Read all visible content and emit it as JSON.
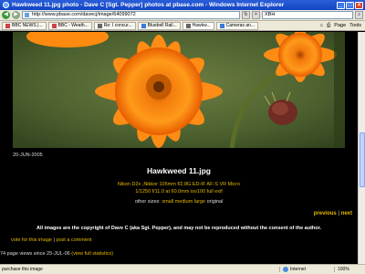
{
  "window": {
    "title": "Hawkweed 11.jpg photo - Dave C [Sgt. Pepper] photos at pbase.com - Windows Internet Explorer"
  },
  "address": {
    "url": "http://www.pbase.com/davecj/image/64099072",
    "search_value": "XBH"
  },
  "tabs": [
    {
      "label": "BBC NEWS |..."
    },
    {
      "label": "BBC - Weath..."
    },
    {
      "label": "Re: I concur..."
    },
    {
      "label": "Bluebell Rail..."
    },
    {
      "label": "Hawkw...",
      "active": true
    },
    {
      "label": "Cameras an..."
    }
  ],
  "toolbar": {
    "page_label": "Page",
    "tools_label": "Tools"
  },
  "page": {
    "date": "20-JUN-2005",
    "photo_title": "Hawkweed 11.jpg",
    "camera_line": "Nikon D2x ,Nikkor 105mm f/2.8G ED-IF AF-S VR Micro",
    "exposure_line": "1/1250 f/11.0 at 60.0mm iso100",
    "full_exif": "full exif",
    "other_sizes_prefix": "other sizes:",
    "size_small": "small",
    "size_medium": "medium",
    "size_large": "large",
    "size_original": "original",
    "previous": "previous",
    "separator": "|",
    "next": "next",
    "copyright": "All images are the copyright of Dave C (aka Sgt. Pepper), and may not be reproduced without the consent of the author.",
    "vote": "vote for this image",
    "post_comment": "post a comment",
    "views_text": "74 page views since 25-JUL-06",
    "view_stats": "(view full statistics)"
  },
  "status": {
    "left": "purchase this image",
    "zone": "Internet",
    "zoom": "100%"
  },
  "colors": {
    "link": "#e6b800",
    "bg": "#000000"
  }
}
